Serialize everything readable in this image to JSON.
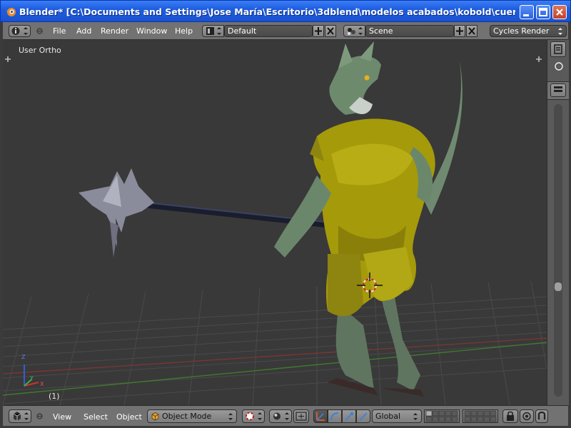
{
  "window": {
    "title": "Blender* [C:\\Documents and Settings\\Jose María\\Escritorio\\3dblend\\modelos acabados\\kobold\\cuerpos\\cuerpo..."
  },
  "header": {
    "menus": [
      "File",
      "Add",
      "Render",
      "Window",
      "Help"
    ],
    "screen_layout": "Default",
    "scene": "Scene",
    "render_engine": "Cycles Render"
  },
  "viewport": {
    "view_label": "User Ortho",
    "frame_label": "(1)",
    "axis_labels": [
      "Z",
      "Y",
      "X"
    ]
  },
  "footer": {
    "menus": [
      "View",
      "Select",
      "Object"
    ],
    "mode": "Object Mode",
    "orientation": "Global"
  },
  "colors": {
    "accent_titlebar": "#1f5ee0",
    "viewport_bg": "#393939",
    "header_bg": "#727272",
    "armor": "#a59a0a",
    "scales": "#6f8a70"
  },
  "icons": [
    "blender-logo-icon",
    "info-editor-icon",
    "screen-layout-icon",
    "scene-icon",
    "add-icon",
    "close-icon",
    "cube-icon",
    "3d-view-icon",
    "pivot-icon",
    "shading-icon",
    "manipulator-icon",
    "translate-icon",
    "rotate-icon",
    "scale-icon",
    "lock-icon",
    "render-preview-icon",
    "snap-icon",
    "tool-icon",
    "properties-icon"
  ]
}
